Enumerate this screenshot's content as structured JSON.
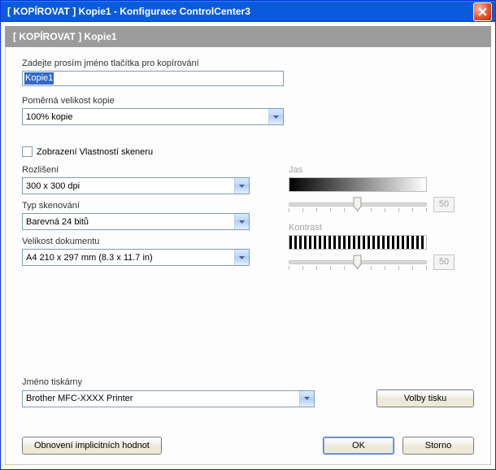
{
  "titlebar": "[ KOPÍROVAT ]   Kopie1 - Konfigurace ControlCenter3",
  "subheader": "[ KOPÍROVAT ]   Kopie1",
  "name_prompt": "Zadejte prosím jméno tlačítka pro kopírování",
  "name_value": "Kopie1",
  "ratio_label": "Poměrná velikost kopie",
  "ratio_value": "100% kopie",
  "show_scanner_props": "Zobrazení Vlastností skeneru",
  "resolution_label": "Rozlišení",
  "resolution_value": "300 x 300 dpi",
  "scantype_label": "Typ skenování",
  "scantype_value": "Barevná 24 bitů",
  "docsize_label": "Velikost dokumentu",
  "docsize_value": "A4 210 x 297 mm (8.3 x 11.7 in)",
  "brightness_label": "Jas",
  "brightness_value": "50",
  "contrast_label": "Kontrast",
  "contrast_value": "50",
  "printer_label": "Jméno tiskárny",
  "printer_value": "Brother MFC-XXXX Printer",
  "print_options_btn": "Volby tisku",
  "restore_defaults_btn": "Obnovení implicitních hodnot",
  "ok_btn": "OK",
  "cancel_btn": "Storno"
}
